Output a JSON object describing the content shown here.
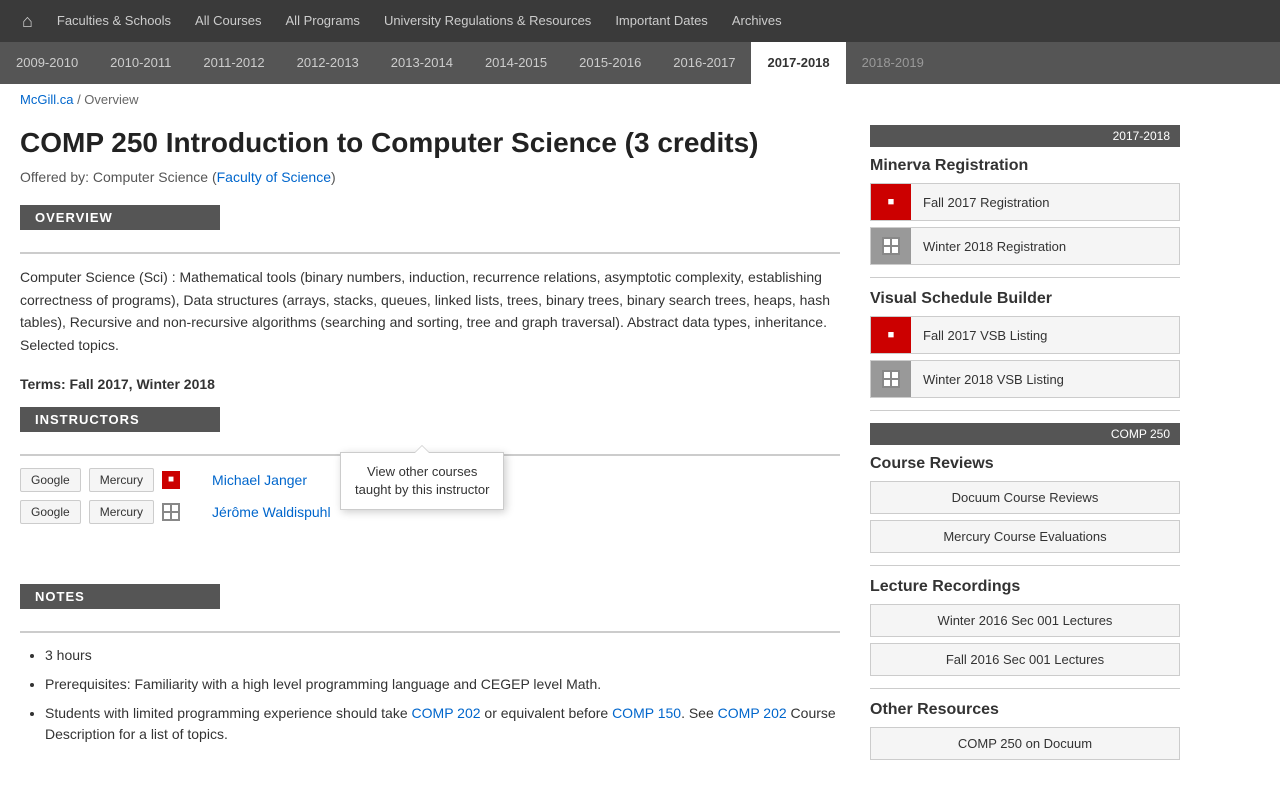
{
  "topnav": {
    "items": [
      {
        "label": "Faculties & Schools",
        "href": "#"
      },
      {
        "label": "All Courses",
        "href": "#"
      },
      {
        "label": "All Programs",
        "href": "#"
      },
      {
        "label": "University Regulations & Resources",
        "href": "#"
      },
      {
        "label": "Important Dates",
        "href": "#"
      },
      {
        "label": "Archives",
        "href": "#"
      }
    ]
  },
  "yearnav": {
    "years": [
      {
        "label": "2009-2010",
        "active": false
      },
      {
        "label": "2010-2011",
        "active": false
      },
      {
        "label": "2011-2012",
        "active": false
      },
      {
        "label": "2012-2013",
        "active": false
      },
      {
        "label": "2013-2014",
        "active": false
      },
      {
        "label": "2014-2015",
        "active": false
      },
      {
        "label": "2015-2016",
        "active": false
      },
      {
        "label": "2016-2017",
        "active": false
      },
      {
        "label": "2017-2018",
        "active": true
      },
      {
        "label": "2018-2019",
        "active": false,
        "future": true
      }
    ]
  },
  "breadcrumb": {
    "site": "McGill.ca",
    "separator": " / ",
    "page": "Overview"
  },
  "course": {
    "title": "COMP 250 Introduction to Computer Science (3 credits)",
    "offered_by": "Offered by: Computer Science (",
    "faculty_link": "Faculty of Science",
    "offered_by_end": ")",
    "overview_label": "OVERVIEW",
    "overview_text": "Computer Science (Sci) : Mathematical tools (binary numbers, induction, recurrence relations, asymptotic complexity, establishing correctness of programs), Data structures (arrays, stacks, queues, linked lists, trees, binary trees, binary search trees, heaps, hash tables), Recursive and non-recursive algorithms (searching and sorting, tree and graph traversal). Abstract data types, inheritance. Selected topics.",
    "terms_label": "Terms: Fall 2017, Winter 2018",
    "instructors_label": "INSTRUCTORS",
    "instructors": [
      {
        "id": 1,
        "google_label": "Google",
        "mercury_label": "Mercury",
        "icon_type": "red",
        "name": "Michael Janger"
      },
      {
        "id": 2,
        "google_label": "Google",
        "mercury_label": "Mercury",
        "icon_type": "grid",
        "name": "Jérôme Waldispuhl"
      }
    ],
    "tooltip_text": "View other courses\ntaught by this instructor",
    "notes_label": "NOTES",
    "notes": [
      "3 hours",
      "Prerequisites: Familiarity with a high level programming language and CEGEP level Math.",
      "Students with limited programming experience should take COMP 202 or equivalent before COMP 150. See COMP 202 Course Description for a list of topics."
    ],
    "notes_links": {
      "comp202_1": "COMP 202",
      "comp150": "COMP 150",
      "comp202_2": "COMP 202"
    }
  },
  "sidebar": {
    "year_badge": "2017-2018",
    "minerva_title": "Minerva Registration",
    "minerva_items": [
      {
        "label": "Fall 2017 Registration",
        "icon": "red"
      },
      {
        "label": "Winter 2018 Registration",
        "icon": "grid"
      }
    ],
    "vsb_title": "Visual Schedule Builder",
    "vsb_items": [
      {
        "label": "Fall 2017 VSB Listing",
        "icon": "red"
      },
      {
        "label": "Winter 2018 VSB Listing",
        "icon": "grid"
      }
    ],
    "course_badge": "COMP 250",
    "reviews_title": "Course Reviews",
    "review_items": [
      {
        "label": "Docuum Course Reviews"
      },
      {
        "label": "Mercury Course Evaluations"
      }
    ],
    "lecture_title": "Lecture Recordings",
    "lecture_items": [
      {
        "label": "Winter 2016 Sec 001 Lectures"
      },
      {
        "label": "Fall 2016 Sec 001 Lectures"
      }
    ],
    "other_title": "Other Resources",
    "other_items": [
      {
        "label": "COMP 250 on Docuum"
      }
    ]
  }
}
